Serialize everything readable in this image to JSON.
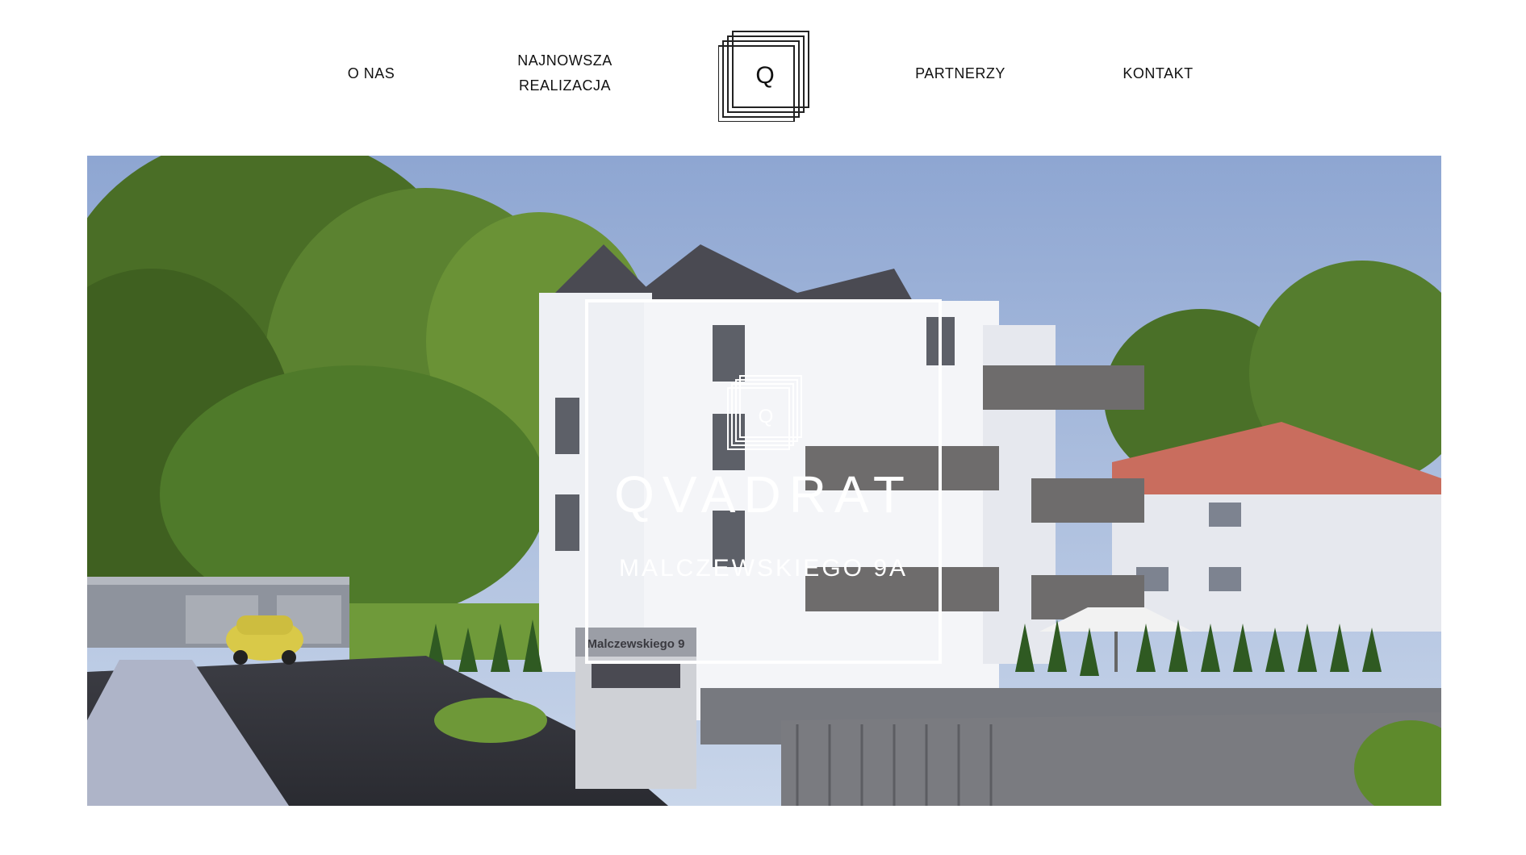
{
  "nav": {
    "items": [
      {
        "label": "O NAS"
      },
      {
        "label_line1": "NAJNOWSZA",
        "label_line2": "REALIZACJA"
      },
      {
        "label": "PARTNERZY"
      },
      {
        "label": "KONTAKT"
      }
    ],
    "logo_letter": "Q"
  },
  "hero": {
    "title": "QVADRAT",
    "subtitle": "MALCZEWSKIEGO 9A",
    "logo_letter": "Q",
    "street_sign": "Malczewskiego 9",
    "image": "apartment-building-rendering"
  },
  "colors": {
    "text": "#111111",
    "overlay": "#ffffff",
    "sky": "#9fb4d4",
    "foliage": "#4f7a2a",
    "roof_red": "#c96d5e",
    "roof_dark": "#4a4a52"
  }
}
